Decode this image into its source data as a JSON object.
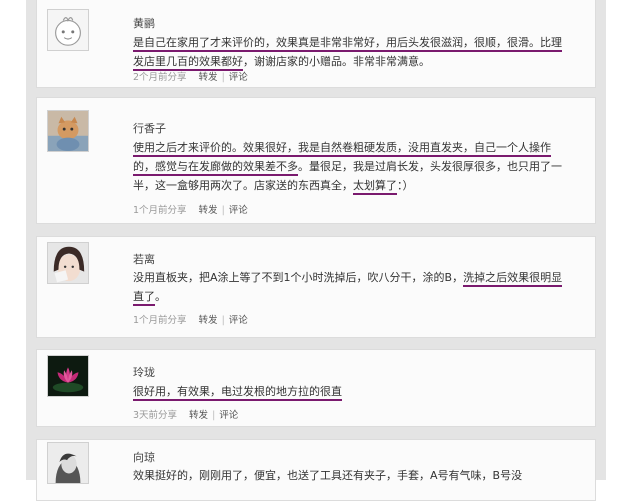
{
  "posts": [
    {
      "author": "黄鹂",
      "segments": [
        {
          "t": "是自己在家用了才来评价的，效果真是非常非常好，用后头发很滋润，很顺，很滑。比理发店里几百的效果都好",
          "u": true
        },
        {
          "t": "，谢谢店家的小赠品。非常非常满意。",
          "u": false
        }
      ],
      "time": "2个月前分享",
      "actions": [
        "转发",
        "评论"
      ],
      "avatar_icon": "cartoon-avatar-icon"
    },
    {
      "author": "行香子",
      "segments": [
        {
          "t": "使用之后才来评价的。效果很好，我是自然卷粗硬发质，没用直发夹，自己一个人操作的，感觉与在发廊做的效果差不多",
          "u": true
        },
        {
          "t": "。量很足，我是过肩长发，头发很厚很多，也只用了一半，这一盒够用两次了。店家送的东西真全，",
          "u": false
        },
        {
          "t": "太划算了",
          "u": true
        },
        {
          "t": "：）",
          "u": false
        }
      ],
      "time": "1个月前分享",
      "actions": [
        "转发",
        "评论"
      ],
      "avatar_icon": "cat-photo-avatar-icon"
    },
    {
      "author": "若离",
      "segments": [
        {
          "t": "没用直板夹，把A涂上等了不到1个小时洗掉后，吹八分干，涂的B，",
          "u": false
        },
        {
          "t": "洗掉之后效果很明显直了",
          "u": true
        },
        {
          "t": "。",
          "u": false
        }
      ],
      "time": "1个月前分享",
      "actions": [
        "转发",
        "评论"
      ],
      "avatar_icon": "girl-photo-avatar-icon"
    },
    {
      "author": "玲珑",
      "segments": [
        {
          "t": "很好用，有效果，电过发根的地方拉的很直",
          "u": true
        }
      ],
      "time": "3天前分享",
      "actions": [
        "转发",
        "评论"
      ],
      "avatar_icon": "lotus-photo-avatar-icon"
    },
    {
      "author": "向琼",
      "segments": [
        {
          "t": "效果挺好的，刚刚用了，便宜，也送了工具还有夹子，手套，A号有气味，B号没",
          "u": false
        }
      ],
      "time": "",
      "actions": [],
      "avatar_icon": "sketch-avatar-icon"
    }
  ],
  "colors": {
    "underline": "#7a1a6e",
    "page_bg": "#e4e4e4"
  }
}
